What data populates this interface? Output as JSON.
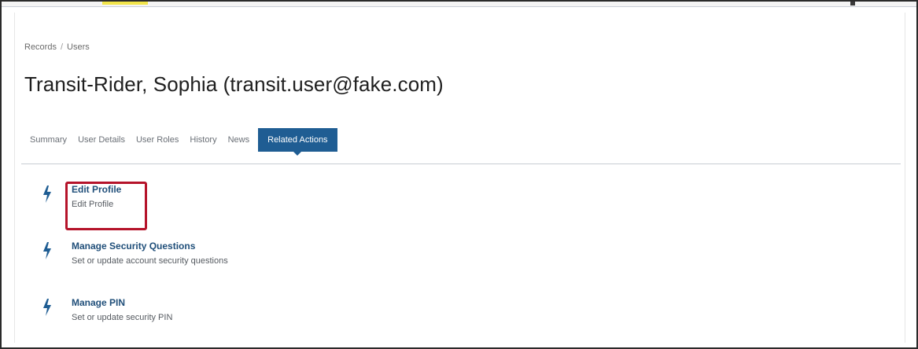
{
  "breadcrumb": {
    "items": [
      "Records",
      "Users"
    ],
    "separator": "/"
  },
  "page": {
    "title": "Transit-Rider, Sophia (transit.user@fake.com)"
  },
  "tabs": [
    {
      "label": "Summary",
      "active": false
    },
    {
      "label": "User Details",
      "active": false
    },
    {
      "label": "User Roles",
      "active": false
    },
    {
      "label": "History",
      "active": false
    },
    {
      "label": "News",
      "active": false
    },
    {
      "label": "Related Actions",
      "active": true
    }
  ],
  "actions": [
    {
      "title": "Edit Profile",
      "description": "Edit Profile",
      "icon": "bolt-icon",
      "highlighted": true
    },
    {
      "title": "Manage Security Questions",
      "description": "Set or update account security questions",
      "icon": "bolt-icon",
      "highlighted": false
    },
    {
      "title": "Manage PIN",
      "description": "Set or update security PIN",
      "icon": "bolt-icon",
      "highlighted": false
    }
  ],
  "colors": {
    "accent": "#1f5d93",
    "highlight": "#b5132a",
    "link": "#1f4e79",
    "topbar_accent": "#f2e54b"
  }
}
